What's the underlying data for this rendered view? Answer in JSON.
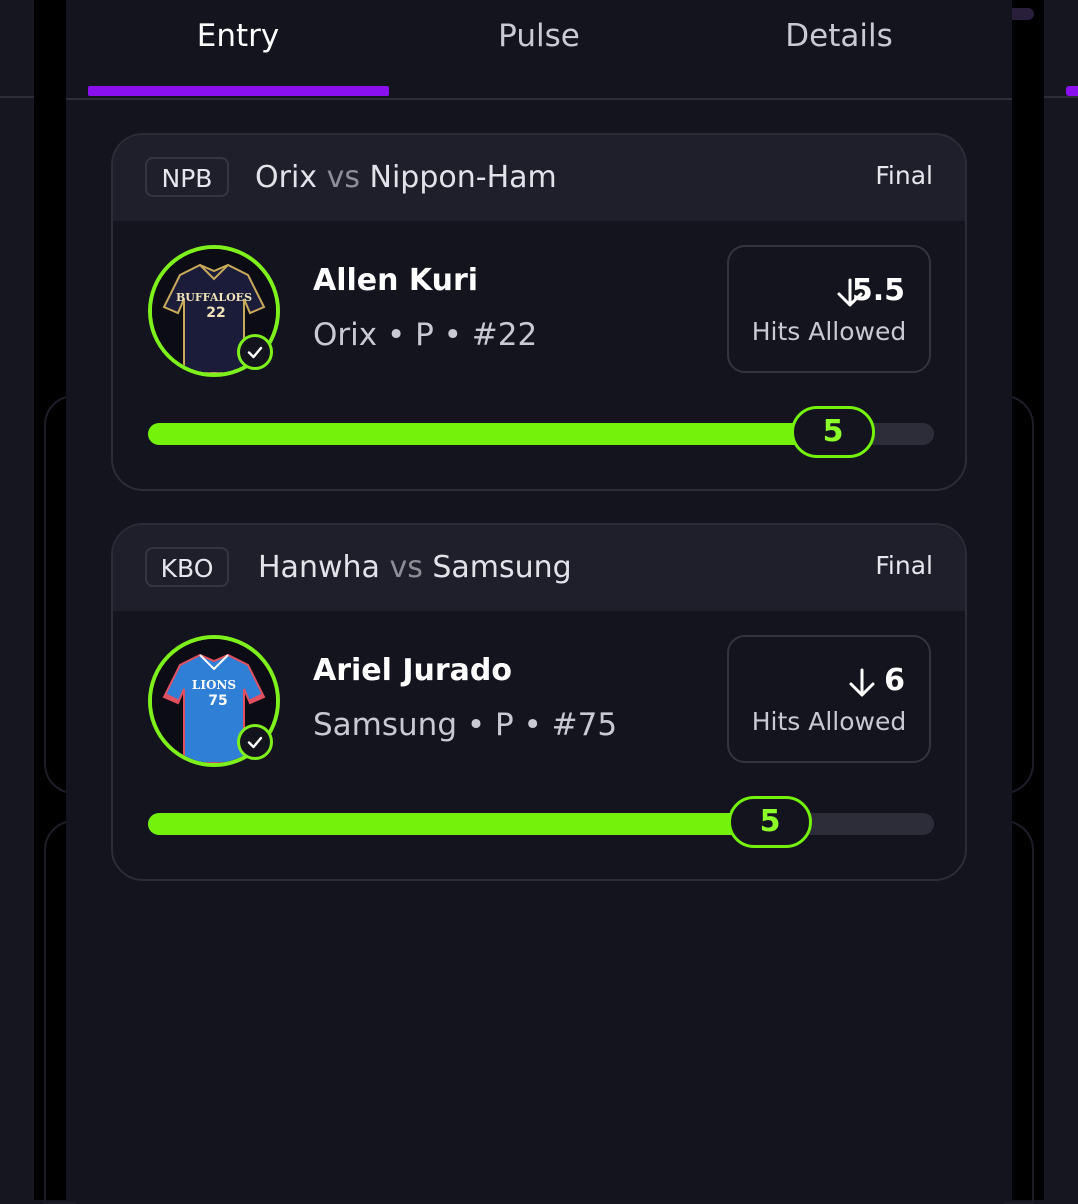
{
  "tabs": [
    {
      "label": "Entry",
      "active": true
    },
    {
      "label": "Pulse",
      "active": false
    },
    {
      "label": "Details",
      "active": false
    }
  ],
  "accent_color": "#8b10f0",
  "progress_color": "#74f20c",
  "picks": [
    {
      "league": "NPB",
      "home": "Orix",
      "vs": "vs",
      "away": "Nippon-Ham",
      "status": "Final",
      "player_name": "Allen Kuri",
      "player_meta": "Orix • P • #22",
      "avatar_icon": "buffaloes-jersey-icon",
      "jersey_text": "BUFFALOES",
      "jersey_number": "22",
      "direction": "under",
      "line": "5.5",
      "stat": "Hits Allowed",
      "actual": "5",
      "progress": 0.91
    },
    {
      "league": "KBO",
      "home": "Hanwha",
      "vs": "vs",
      "away": "Samsung",
      "status": "Final",
      "player_name": "Ariel Jurado",
      "player_meta": "Samsung • P • #75",
      "avatar_icon": "lions-jersey-icon",
      "jersey_text": "LIONS",
      "jersey_number": "75",
      "direction": "under",
      "line": "6",
      "stat": "Hits Allowed",
      "actual": "5",
      "progress": 0.83
    }
  ]
}
